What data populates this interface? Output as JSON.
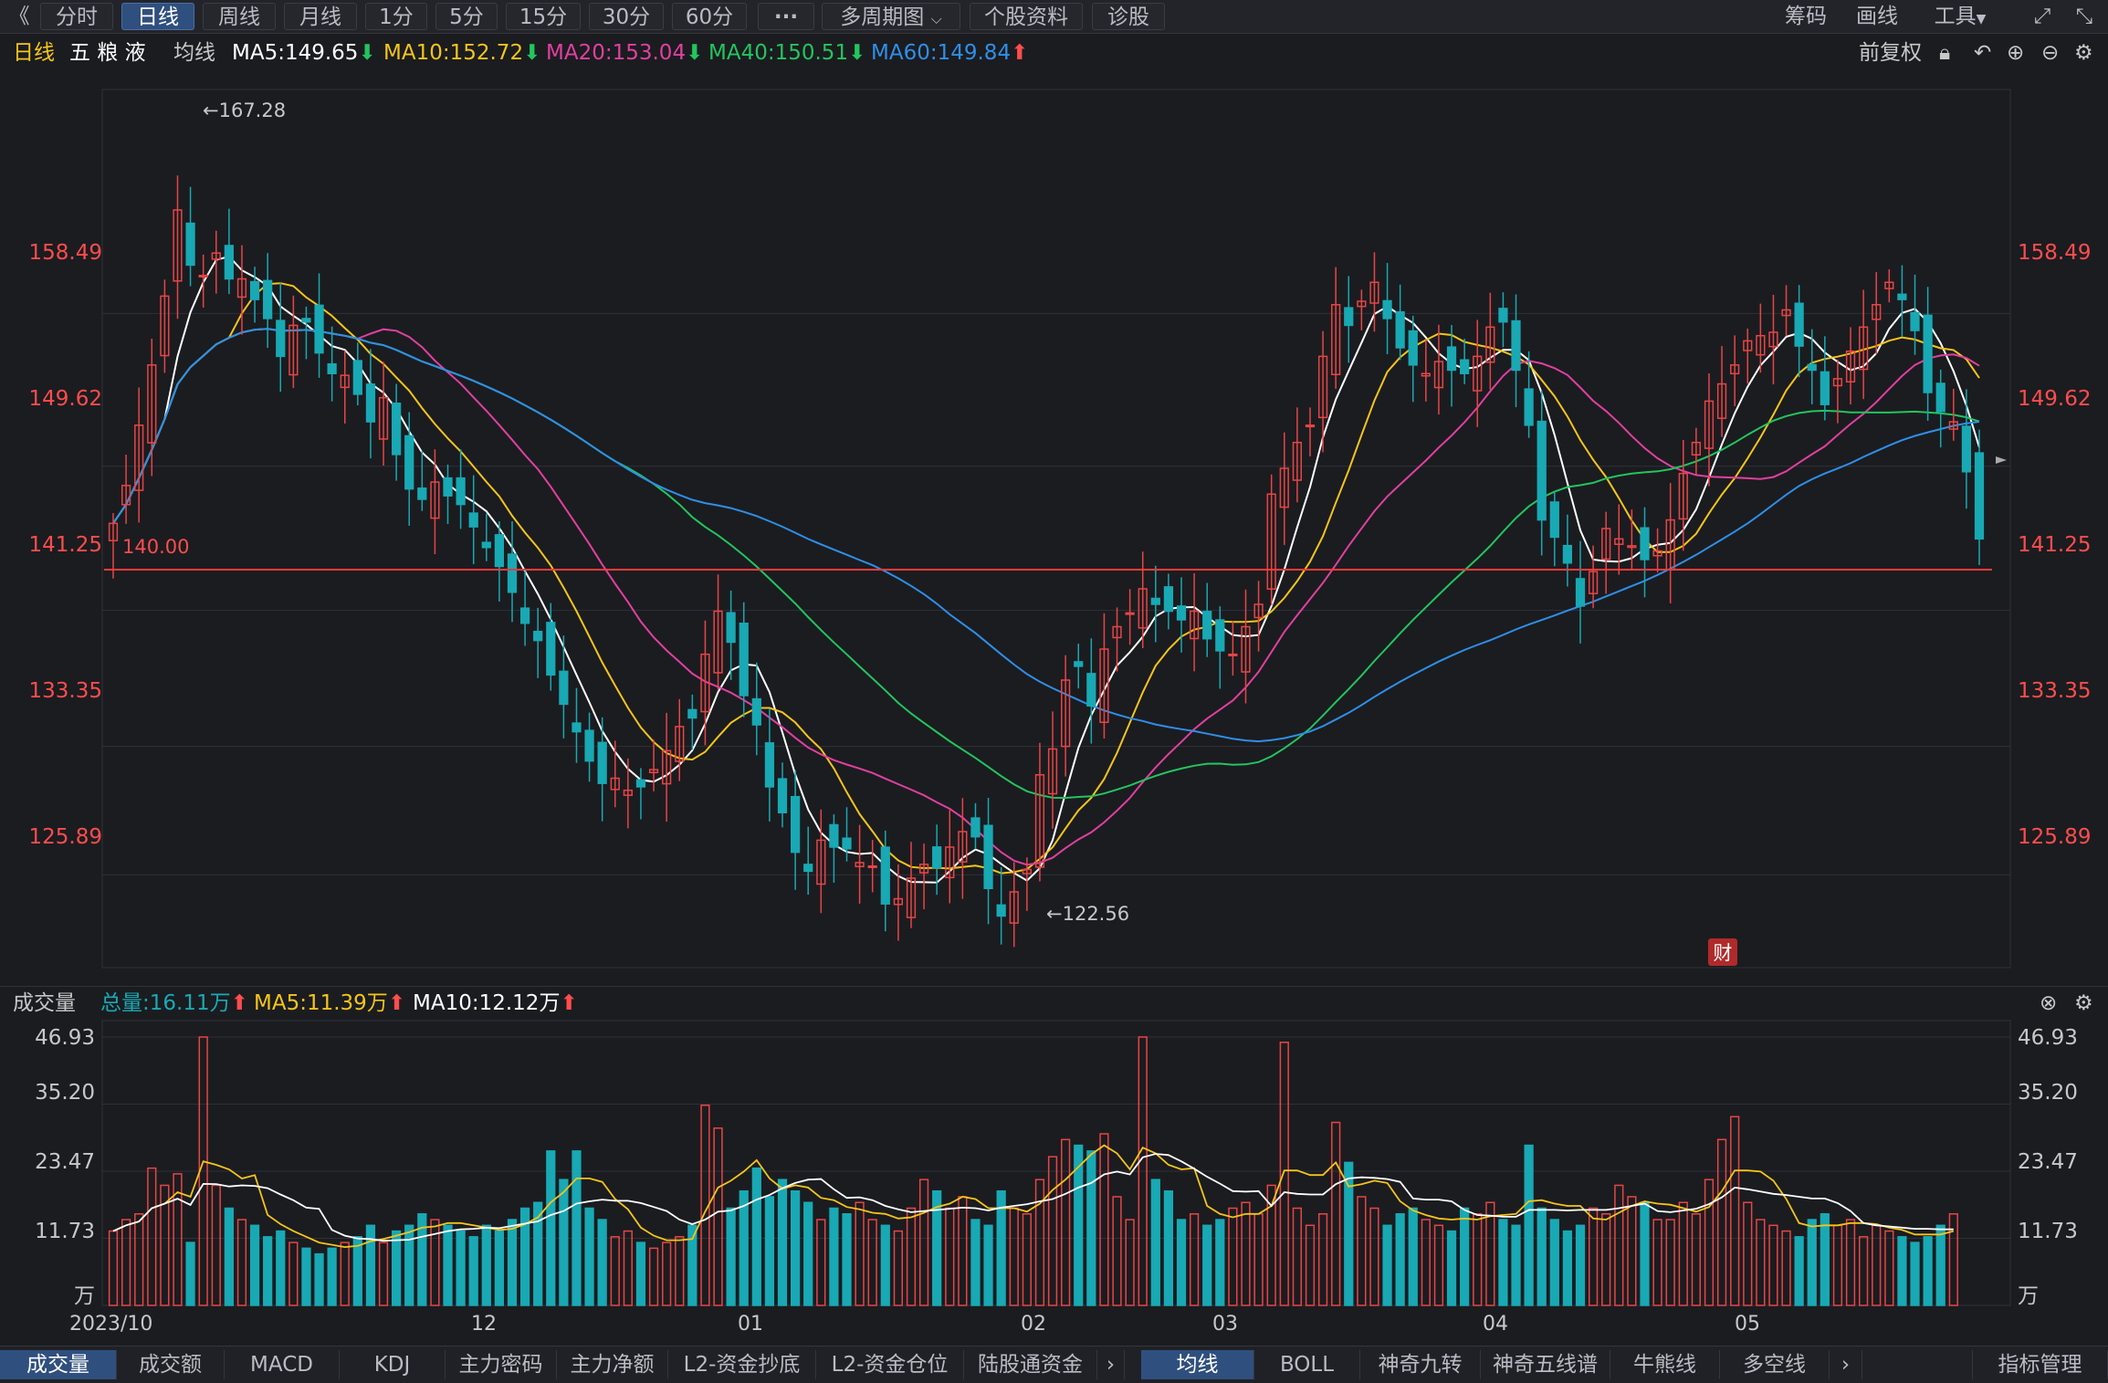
{
  "toolbar": {
    "collapse": "《",
    "tabs": [
      "分时",
      "日线",
      "周线",
      "月线",
      "1分",
      "5分",
      "15分",
      "30分",
      "60分",
      "···",
      "多周期图",
      "个股资料",
      "诊股"
    ],
    "active_tab": "日线",
    "right": [
      "筹码",
      "画线",
      "工具"
    ]
  },
  "info": {
    "period": "日线",
    "stock": "五 粮 液",
    "indicator": "均线",
    "ma5": "MA5:149.65",
    "ma10": "MA10:152.72",
    "ma20": "MA20:153.04",
    "ma40": "MA40:150.51",
    "ma60": "MA60:149.84",
    "adjust": "前复权"
  },
  "colors": {
    "up": "#e84545",
    "down": "#18a9b4",
    "ma5": "#ffffff",
    "ma10": "#f5c518",
    "ma20": "#e040a0",
    "ma40": "#22c55e",
    "ma60": "#2f8fe8",
    "axis_red": "#ff4d4d"
  },
  "price_axis": [
    "158.49",
    "149.62",
    "141.25",
    "133.35",
    "125.89"
  ],
  "annotations": {
    "high": "←167.28",
    "low": "←122.56",
    "line": "140.00",
    "badge": "财"
  },
  "volume": {
    "title": "成交量",
    "total": "总量:16.11万",
    "ma5": "MA5:11.39万",
    "ma10": "MA10:12.12万",
    "axis": [
      "46.93",
      "35.20",
      "23.47",
      "11.73",
      "万"
    ]
  },
  "x_labels": [
    "2023/10",
    "12",
    "01",
    "02",
    "03",
    "04",
    "05"
  ],
  "bottom_tabs": [
    "成交量",
    "成交额",
    "MACD",
    "KDJ",
    "主力密码",
    "主力净额",
    "L2-资金抄底",
    "L2-资金仓位",
    "陆股通资金"
  ],
  "bottom_tabs2": [
    "均线",
    "BOLL",
    "神奇九转",
    "神奇五线谱",
    "牛熊线",
    "多空线"
  ],
  "indicator_manage": "指标管理",
  "chart_data": {
    "type": "candlestick",
    "title": "五粮液 日线",
    "close": [
      146.3,
      148.5,
      152.0,
      155.5,
      159.5,
      164.5,
      161.3,
      160.7,
      162.0,
      160.5,
      160.5,
      159.3,
      158.2,
      156.0,
      157.8,
      158.0,
      156.2,
      155.0,
      154.9,
      153.8,
      152.2,
      153.6,
      150.3,
      148.3,
      147.7,
      148.7,
      147.9,
      147.4,
      146.1,
      144.9,
      143.8,
      142.3,
      140.5,
      139.5,
      137.5,
      135.8,
      134.2,
      132.5,
      131.2,
      131.5,
      130.8,
      131.0,
      132.0,
      133.1,
      134.5,
      135.0,
      138.7,
      141.2,
      139.4,
      136.3,
      134.6,
      131.0,
      129.5,
      127.2,
      126.1,
      127.9,
      127.5,
      127.4,
      126.6,
      126.4,
      124.2,
      124.5,
      125.7,
      126.5,
      126.3,
      127.5,
      128.4,
      128.1,
      125.1,
      123.5,
      124.9,
      126.2,
      131.7,
      133.2,
      137.2,
      138.0,
      135.7,
      139.0,
      140.3,
      141.1,
      142.5,
      141.6,
      141.2,
      140.7,
      141.2,
      139.6,
      138.9,
      138.7,
      140.3,
      141.6,
      148.0,
      149.5,
      151.0,
      152.0,
      156.0,
      159.0,
      157.8,
      159.2,
      160.3,
      158.2,
      156.5,
      155.5,
      155.0,
      155.7,
      155.2,
      155.0,
      156.0,
      157.7,
      158.0,
      155.2,
      152.0,
      146.5,
      145.5,
      144.0,
      141.5,
      143.5,
      146.0,
      145.4,
      145.0,
      144.2,
      144.7,
      146.5,
      149.2,
      151.0,
      153.4,
      154.4,
      155.5,
      156.9,
      157.2,
      157.4,
      158.7,
      156.6,
      155.2,
      153.2,
      154.7,
      156.3,
      157.7,
      159.0,
      160.3,
      159.3,
      157.5,
      153.9,
      152.8,
      152.2,
      149.3,
      145.4
    ],
    "volume": [
      13,
      15,
      16,
      24,
      21,
      23,
      11,
      46.93,
      21,
      17,
      15,
      14,
      12,
      13,
      11,
      10,
      9,
      10,
      11,
      12,
      14,
      11,
      13,
      14,
      16,
      15,
      14,
      13,
      12,
      14,
      13,
      15,
      17,
      18,
      27,
      22,
      27,
      17,
      15,
      12,
      13,
      11,
      10,
      11,
      12,
      14,
      35,
      31,
      17,
      20,
      24,
      19,
      22,
      20,
      18,
      15,
      17,
      16,
      18,
      15,
      14,
      13,
      17,
      22,
      20,
      17,
      19,
      15,
      14,
      20,
      17,
      16,
      22,
      26,
      29,
      28,
      27,
      30,
      19,
      15,
      46.93,
      22,
      20,
      15,
      16,
      14,
      15,
      17,
      18,
      16,
      21,
      46,
      17,
      14,
      16,
      32,
      25,
      19,
      17,
      14,
      16,
      17,
      15,
      14,
      13,
      17,
      16,
      18,
      15,
      14,
      28,
      17,
      15,
      13,
      14,
      17,
      16,
      21,
      19,
      18,
      15,
      15,
      18,
      16,
      22,
      29,
      33,
      18,
      15,
      14,
      13,
      12,
      15,
      16,
      14,
      15,
      12,
      14,
      13,
      12,
      11,
      12,
      14,
      16
    ],
    "ma5": [
      149.65
    ],
    "ma10": [
      152.72
    ],
    "ma20": [
      153.04
    ],
    "ma40": [
      150.51
    ],
    "ma60": [
      149.84
    ],
    "ylim": [
      120.5,
      171.5
    ],
    "vol_ylim": [
      0,
      46.93
    ]
  }
}
